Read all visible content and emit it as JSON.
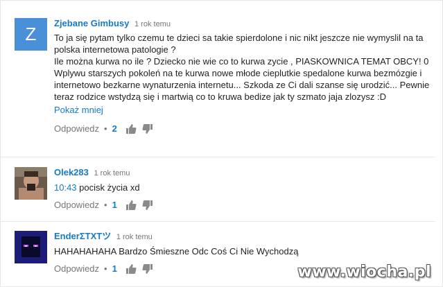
{
  "comments": [
    {
      "author": "Zjebane Gimbusy",
      "time": "1 rok temu",
      "avatar_letter": "Z",
      "lines": [
        "To ja się pytam tylko czemu te dzieci sa takie spierdolone i nic nikt jeszcze nie wymyslil na ta polska internetowa patologie ?",
        "Ile można kurwa no ile ? Dziecko nie wie co to kurwa zycie , PIASKOWNICA TEMAT OBCY! 0 Wplywu starszych pokoleń na te kurwa nowe młode cieplutkie spedalone kurwa bezmózgie i internetowo bezkarne wynaturzenia internetu... Szkoda ze Ci dali szanse się urodzić... Pewnie teraz rodzice wstydzą się i martwią co to kruwa bedize jak ty szmato jaja zlozysz :D"
      ],
      "show_less": "Pokaż mniej",
      "reply_label": "Odpowiedz",
      "likes": "2"
    },
    {
      "author": "Olek283",
      "time": "1 rok temu",
      "timestamp_link": "10:43",
      "text": "pocisk życia xd",
      "reply_label": "Odpowiedz",
      "likes": "1"
    },
    {
      "author": "EnderΣTXTツ",
      "time": "1 rok temu",
      "text": "HAHAHAHAHA Bardzo Śmieszne Odc Coś Ci Nie Wychodzą",
      "reply_label": "Odpowiedz",
      "likes": "1"
    }
  ],
  "watermark": "www.wiocha.pl",
  "colors": {
    "link": "#167ac6",
    "avatar_z": "#4a90d9",
    "muted": "#767676"
  }
}
